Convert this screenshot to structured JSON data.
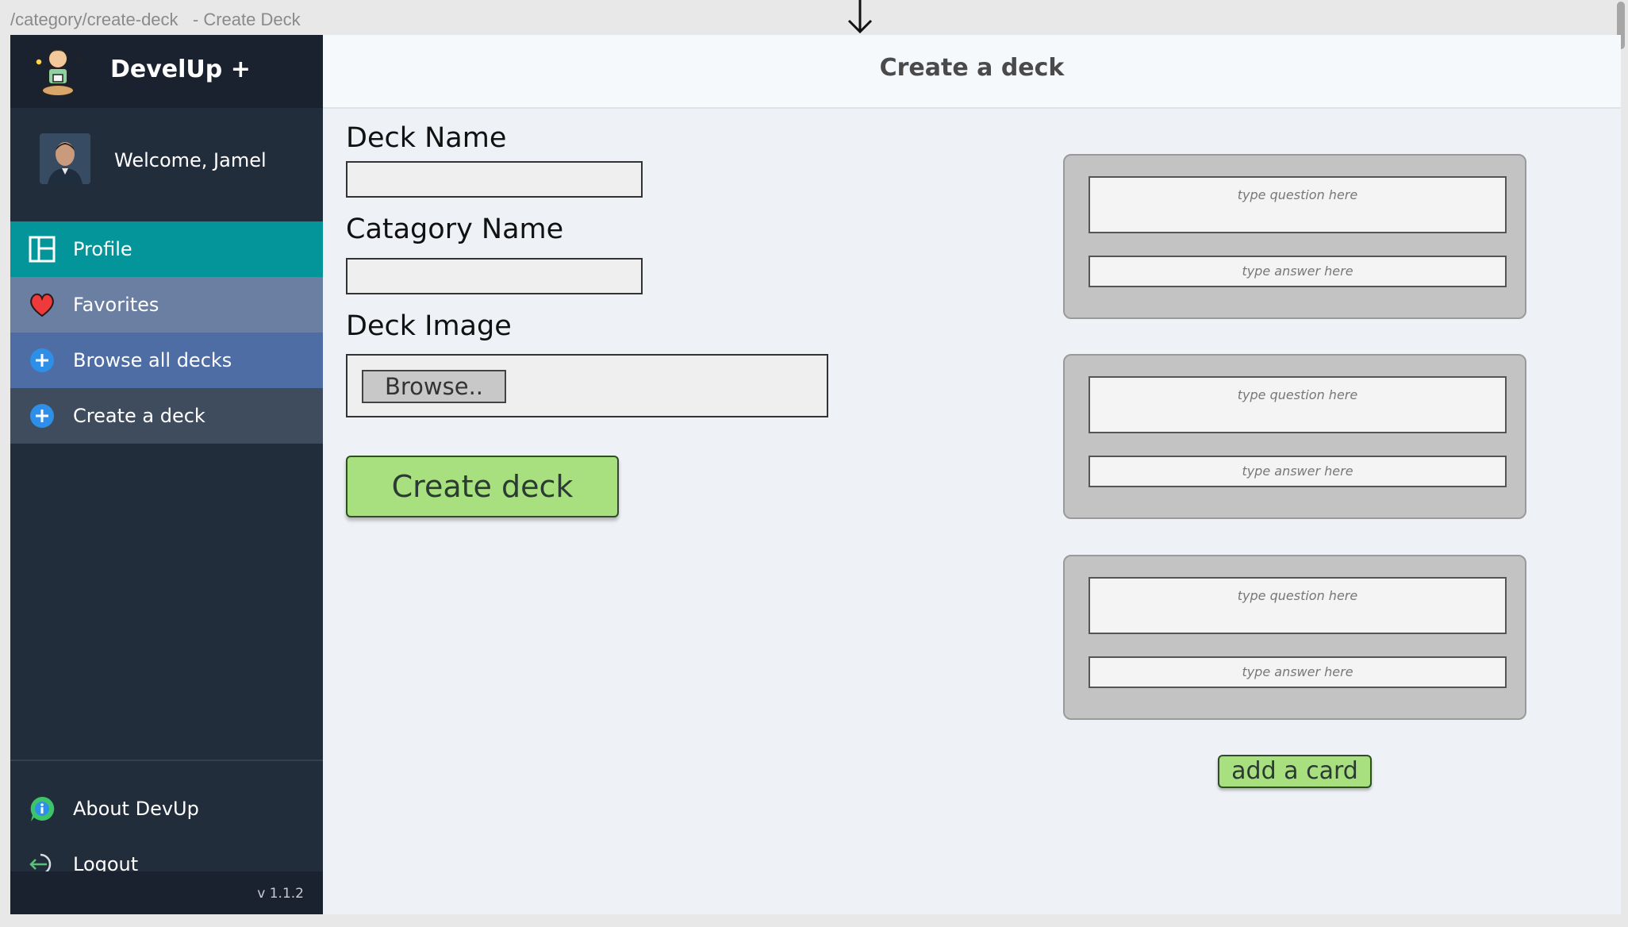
{
  "browser": {
    "url_text": "/category/create-deck   - Create Deck"
  },
  "sidebar": {
    "brand_name": "DevelUp +",
    "welcome_text": "Welcome, Jamel",
    "items": [
      {
        "label": "Profile",
        "icon": "layout-icon"
      },
      {
        "label": "Favorites",
        "icon": "heart-icon"
      },
      {
        "label": "Browse all decks",
        "icon": "plus-circle-icon"
      },
      {
        "label": "Create a deck",
        "icon": "plus-circle-icon"
      }
    ],
    "bottom_items": [
      {
        "label": "About DevUp",
        "icon": "info-icon"
      },
      {
        "label": "Logout",
        "icon": "logout-icon"
      }
    ],
    "version": "v 1.1.2"
  },
  "main": {
    "title": "Create a deck",
    "deck_name_label": "Deck Name",
    "category_name_label": "Catagory Name",
    "deck_image_label": "Deck Image",
    "browse_label": "Browse..",
    "create_button_label": "Create deck",
    "cards": [
      {
        "question_placeholder": "type question here",
        "answer_placeholder": "type answer here"
      },
      {
        "question_placeholder": "type question here",
        "answer_placeholder": "type answer here"
      },
      {
        "question_placeholder": "type question here",
        "answer_placeholder": "type answer here"
      }
    ],
    "add_card_label": "add a card"
  },
  "colors": {
    "sidebar_bg": "#222d3b",
    "active_item": "#03959a",
    "button_green": "#a8e07f"
  }
}
